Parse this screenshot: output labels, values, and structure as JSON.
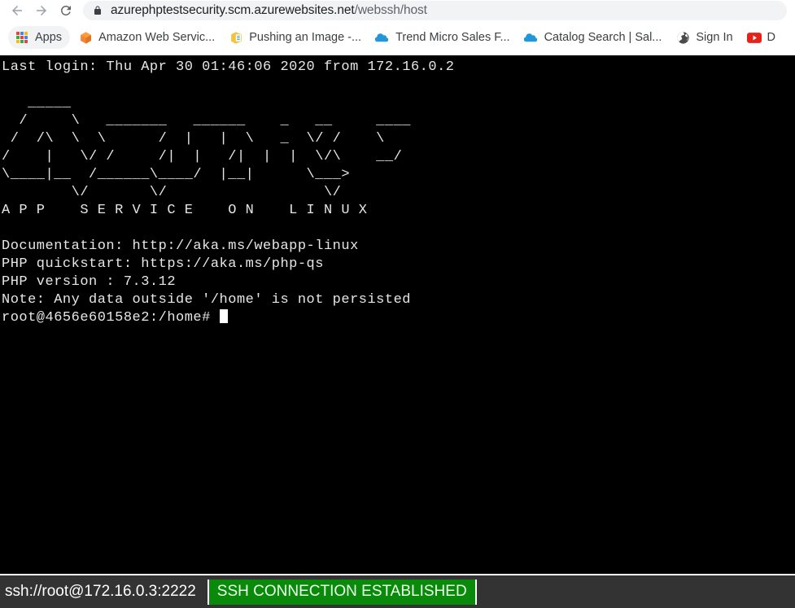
{
  "browser": {
    "nav": {
      "back_label": "Back",
      "forward_label": "Forward",
      "reload_label": "Reload"
    },
    "omnibox": {
      "lock_icon": "lock-icon",
      "url_host": "azurephptestsecurity.scm.azurewebsites.net",
      "url_path": "/webssh/host",
      "url_full": "azurephptestsecurity.scm.azurewebsites.net/webssh/host"
    },
    "bookmarks": [
      {
        "label": "Apps",
        "icon": "apps-grid-icon"
      },
      {
        "label": "Amazon Web Servic...",
        "icon": "aws-cube-icon"
      },
      {
        "label": "Pushing an Image -...",
        "icon": "docs-box-icon"
      },
      {
        "label": "Trend Micro Sales F...",
        "icon": "cloud-icon"
      },
      {
        "label": "Catalog Search | Sal...",
        "icon": "cloud-icon"
      },
      {
        "label": "Sign In",
        "icon": "globe-icon"
      },
      {
        "label": "D",
        "icon": "youtube-icon"
      }
    ]
  },
  "terminal": {
    "last_login": "Last login: Thu Apr 30 01:46:06 2020 from 172.16.0.2",
    "banner_ascii": [
      "   _____           ",
      "  /      \\                                                 ",
      " /  /\\  \\  \\______   ______   ______   _  _   \\/  ___ \\     ",
      "/    |    \\/     /|   |  /|   |  \\/\\    __/                ",
      "\\____|__  /______\\_____/  |__|      \\___>                  ",
      "        \\/       \\/                   \\/                   "
    ],
    "banner_title": "A P P    S E R V I C E    O N    L I N U X",
    "lines": [
      "Documentation: http://aka.ms/webapp-linux",
      "PHP quickstart: https://aka.ms/php-qs",
      "PHP version : 7.3.12",
      "Note: Any data outside '/home' is not persisted"
    ],
    "prompt": "root@4656e60158e2:/home# ",
    "cursor": "block-cursor"
  },
  "status_bar": {
    "endpoint": "ssh://root@172.16.0.3:2222",
    "connection_state": "SSH CONNECTION ESTABLISHED",
    "badge_color": "#0a8a0a",
    "bar_color": "#333333"
  }
}
